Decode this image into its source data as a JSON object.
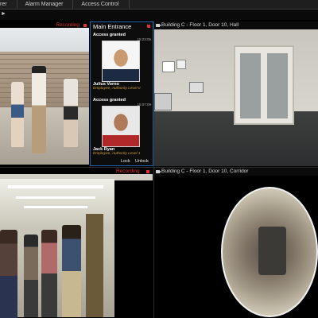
{
  "top_tabs": [
    "rer",
    "Alarm Manager",
    "Access Control"
  ],
  "panes": {
    "video1": {
      "recording_label": "Recording"
    },
    "access": {
      "title": "Main Entrance",
      "events": [
        {
          "status": "Access granted",
          "time": "15:23:05",
          "name": "Julius Vorno",
          "role": "Employee, Authority Level II"
        },
        {
          "status": "Access granted",
          "time": "15:07:09",
          "name": "Jack Ryan",
          "role": "Employee, Authority Level 1"
        }
      ],
      "lock_label": "Lock",
      "unlock_label": "Unlock"
    },
    "hall": {
      "title": "Building C - Floor 1, Door 10, Hall"
    },
    "video2": {
      "recording_label": "Recording"
    },
    "corridor": {
      "title": "Building C - Floor 1, Door 10, Corridor"
    }
  },
  "colors": {
    "selection_border": "#1f5fb0",
    "recording": "#e03030",
    "role_text": "#d4a030"
  }
}
